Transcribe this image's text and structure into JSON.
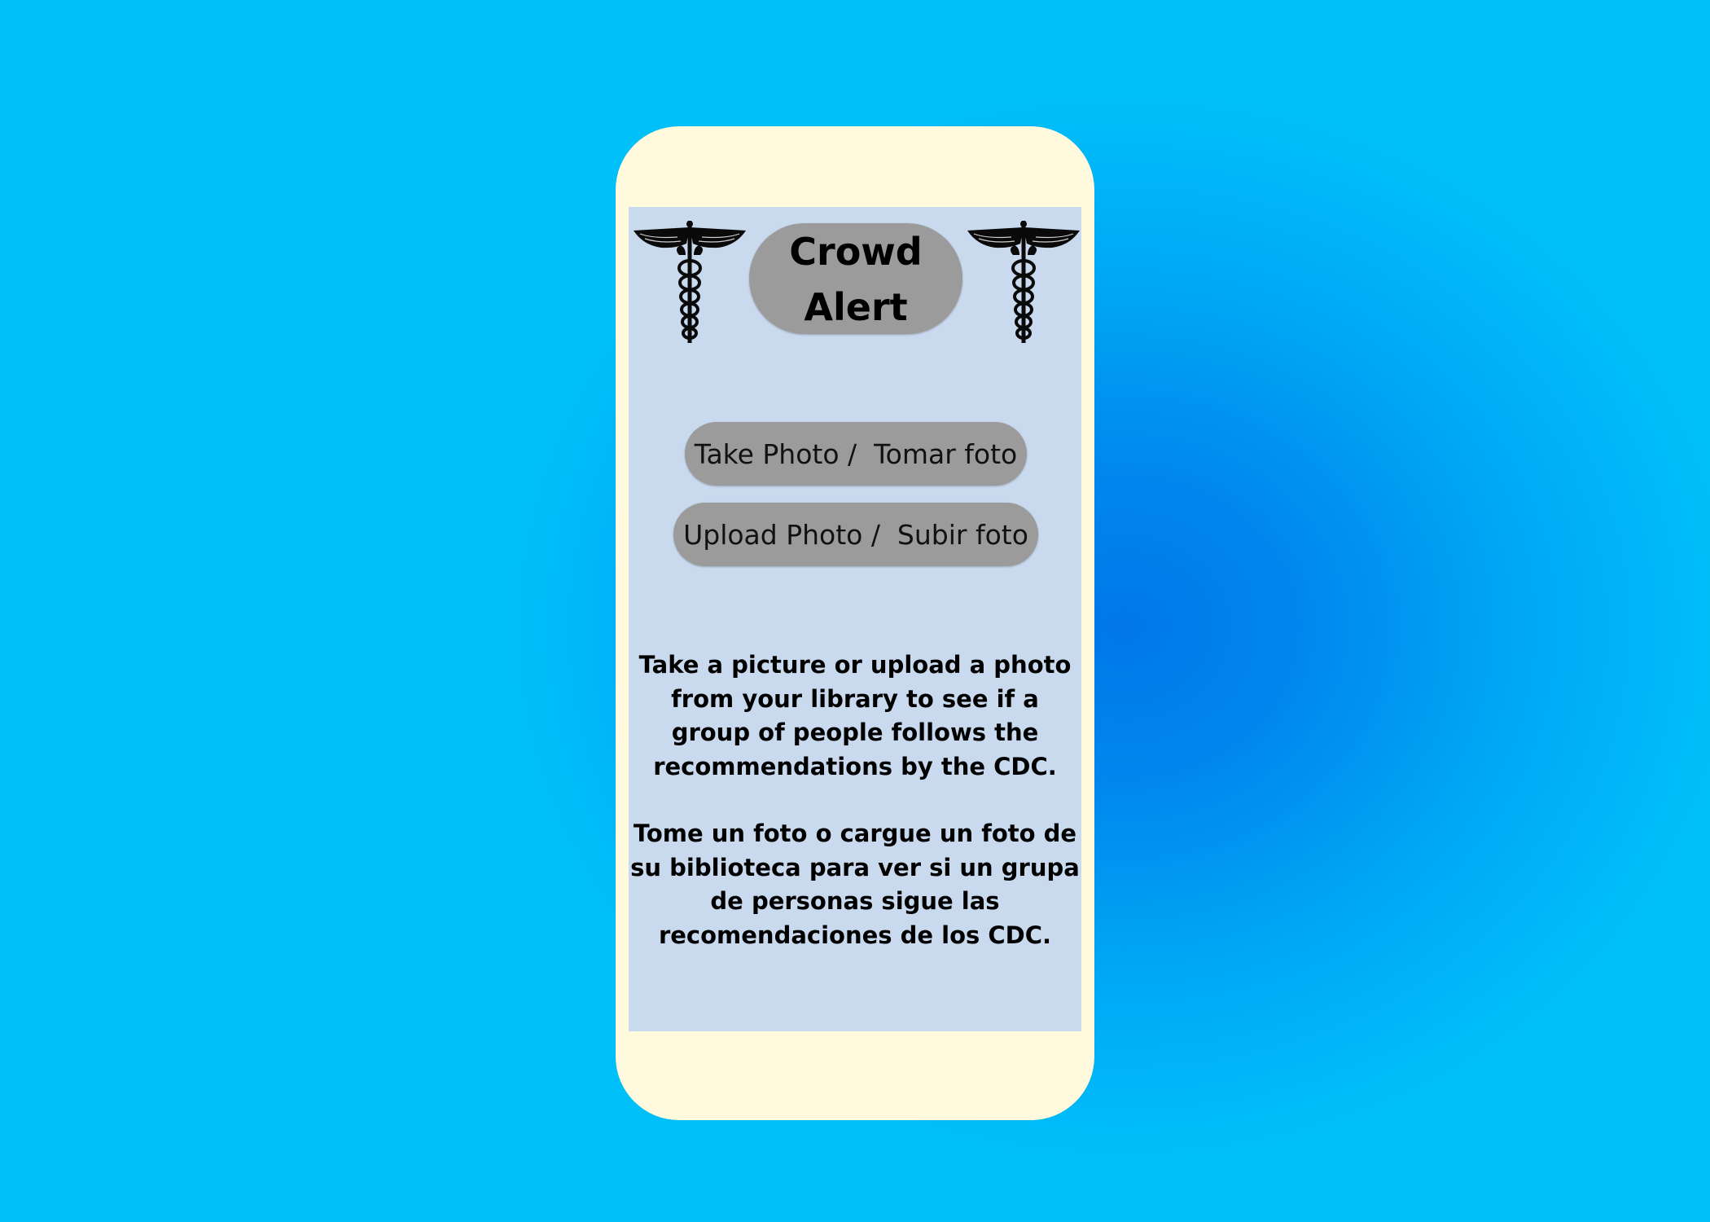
{
  "app": {
    "title": "Crowd Alert"
  },
  "icons": {
    "header_left": "caduceus-icon",
    "header_right": "caduceus-icon"
  },
  "buttons": {
    "take_photo": "Take Photo /  Tomar foto",
    "upload_photo": "Upload Photo /  Subir foto"
  },
  "description": {
    "english": "Take a picture or upload a photo from your library to see if a group of people follows the recommendations by the CDC.",
    "spanish": "Tome un foto o cargue un foto de su biblioteca para ver si un grupa de personas sigue las recomendaciones de los CDC."
  },
  "colors": {
    "background": "#00b4f8",
    "phone_frame": "#fffade",
    "screen": "#c9d9ee",
    "pill": "#9b9b9b"
  }
}
